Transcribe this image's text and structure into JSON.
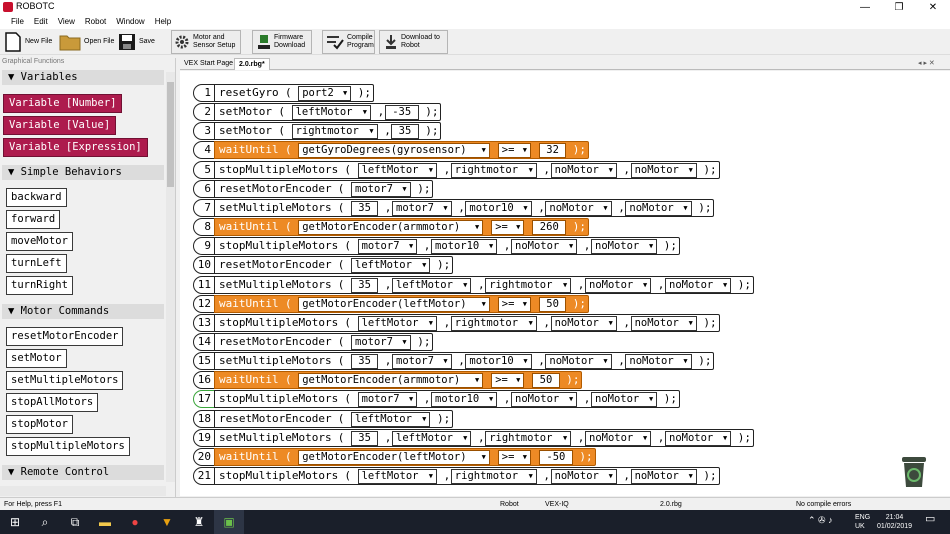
{
  "window": {
    "title": "ROBOTC",
    "min": "—",
    "max": "❐",
    "close": "✕"
  },
  "menu": [
    "File",
    "Edit",
    "View",
    "Robot",
    "Window",
    "Help"
  ],
  "toolbar": {
    "new_file": "New File",
    "open_file": "Open File",
    "save": "Save",
    "motor_setup_1": "Motor and",
    "motor_setup_2": "Sensor Setup",
    "firmware_1": "Firmware",
    "firmware_2": "Download",
    "compile_1": "Compile",
    "compile_2": "Program",
    "download_1": "Download to",
    "download_2": "Robot"
  },
  "sidebar": {
    "header": "Graphical Functions",
    "sections": {
      "variables": "▼ Variables",
      "simple": "▼ Simple Behaviors",
      "motor": "▼ Motor Commands",
      "remote": "▼ Remote Control"
    },
    "variables": [
      "Variable [Number]",
      "Variable [Value]",
      "Variable [Expression]"
    ],
    "simple": [
      "backward",
      "forward",
      "moveMotor",
      "turnLeft",
      "turnRight"
    ],
    "motor": [
      "resetMotorEncoder",
      "setMotor",
      "setMultipleMotors",
      "stopAllMotors",
      "stopMotor",
      "stopMultipleMotors"
    ]
  },
  "tabs": {
    "start": "VEX Start Page",
    "file": "2.0.rbg*"
  },
  "program": [
    {
      "n": "1",
      "fn": "resetGyro",
      "args": [
        "port2"
      ]
    },
    {
      "n": "2",
      "fn": "setMotor",
      "args": [
        "leftMotor",
        "-35"
      ]
    },
    {
      "n": "3",
      "fn": "setMotor",
      "args": [
        "rightmotor",
        "35"
      ]
    },
    {
      "n": "4",
      "fn": "waitUntil",
      "args": [
        "getGyroDegrees(gyrosensor)",
        ">=",
        "32"
      ]
    },
    {
      "n": "5",
      "fn": "stopMultipleMotors",
      "args": [
        "leftMotor",
        "rightmotor",
        "noMotor",
        "noMotor"
      ]
    },
    {
      "n": "6",
      "fn": "resetMotorEncoder",
      "args": [
        "motor7"
      ]
    },
    {
      "n": "7",
      "fn": "setMultipleMotors",
      "args": [
        "35",
        "motor7",
        "motor10",
        "noMotor",
        "noMotor"
      ]
    },
    {
      "n": "8",
      "fn": "waitUntil",
      "args": [
        "getMotorEncoder(armmotor)",
        ">=",
        "260"
      ]
    },
    {
      "n": "9",
      "fn": "stopMultipleMotors",
      "args": [
        "motor7",
        "motor10",
        "noMotor",
        "noMotor"
      ]
    },
    {
      "n": "10",
      "fn": "resetMotorEncoder",
      "args": [
        "leftMotor"
      ]
    },
    {
      "n": "11",
      "fn": "setMultipleMotors",
      "args": [
        "35",
        "leftMotor",
        "rightmotor",
        "noMotor",
        "noMotor"
      ]
    },
    {
      "n": "12",
      "fn": "waitUntil",
      "args": [
        "getMotorEncoder(leftMotor)",
        ">=",
        "50"
      ]
    },
    {
      "n": "13",
      "fn": "stopMultipleMotors",
      "args": [
        "leftMotor",
        "rightmotor",
        "noMotor",
        "noMotor"
      ]
    },
    {
      "n": "14",
      "fn": "resetMotorEncoder",
      "args": [
        "motor7"
      ]
    },
    {
      "n": "15",
      "fn": "setMultipleMotors",
      "args": [
        "35",
        "motor7",
        "motor10",
        "noMotor",
        "noMotor"
      ]
    },
    {
      "n": "16",
      "fn": "waitUntil",
      "args": [
        "getMotorEncoder(armmotor)",
        ">=",
        "50"
      ]
    },
    {
      "n": "17",
      "fn": "stopMultipleMotors",
      "args": [
        "motor7",
        "motor10",
        "noMotor",
        "noMotor"
      ]
    },
    {
      "n": "18",
      "fn": "resetMotorEncoder",
      "args": [
        "leftMotor"
      ]
    },
    {
      "n": "19",
      "fn": "setMultipleMotors",
      "args": [
        "35",
        "leftMotor",
        "rightmotor",
        "noMotor",
        "noMotor"
      ]
    },
    {
      "n": "20",
      "fn": "waitUntil",
      "args": [
        "getMotorEncoder(leftMotor)",
        ">=",
        "-50"
      ]
    },
    {
      "n": "21",
      "fn": "stopMultipleMotors",
      "args": [
        "leftMotor",
        "rightmotor",
        "noMotor",
        "noMotor"
      ]
    }
  ],
  "status": {
    "help": "For Help, press F1",
    "target": "Robot",
    "platform": "VEX-IQ",
    "file": "2.0.rbg",
    "compile": "No compile errors"
  },
  "tray": {
    "lang1": "ENG",
    "lang2": "UK",
    "time": "21:04",
    "date": "01/02/2019"
  },
  "colors": {
    "variable": "#ad1b4d",
    "waitUntil": "#ed8a25"
  }
}
